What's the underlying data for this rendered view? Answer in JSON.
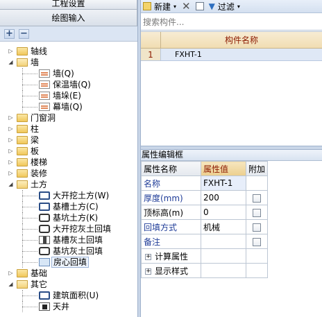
{
  "left": {
    "tab_top": "工程设置",
    "tab_draw": "绘图输入",
    "add_label": "+",
    "remove_label": "−",
    "tree": [
      {
        "label": "轴线",
        "level": 0,
        "exp": "▷",
        "icon": "folder-icon"
      },
      {
        "label": "墙",
        "level": 0,
        "exp": "◢",
        "icon": "folder-open-icon"
      },
      {
        "label": "墙(Q)",
        "level": 1,
        "icon": "wall-icon"
      },
      {
        "label": "保温墙(Q)",
        "level": 1,
        "icon": "insulation-wall-icon"
      },
      {
        "label": "墙垛(E)",
        "level": 1,
        "icon": "wall-pier-icon"
      },
      {
        "label": "幕墙(Q)",
        "level": 1,
        "icon": "curtain-wall-icon"
      },
      {
        "label": "门窗洞",
        "level": 0,
        "exp": "▷",
        "icon": "folder-icon"
      },
      {
        "label": "柱",
        "level": 0,
        "exp": "▷",
        "icon": "folder-icon"
      },
      {
        "label": "梁",
        "level": 0,
        "exp": "▷",
        "icon": "folder-icon"
      },
      {
        "label": "板",
        "level": 0,
        "exp": "▷",
        "icon": "folder-icon"
      },
      {
        "label": "楼梯",
        "level": 0,
        "exp": "▷",
        "icon": "folder-icon"
      },
      {
        "label": "装修",
        "level": 0,
        "exp": "▷",
        "icon": "folder-icon"
      },
      {
        "label": "土方",
        "level": 0,
        "exp": "◢",
        "icon": "folder-open-icon"
      },
      {
        "label": "大开挖土方(W)",
        "level": 1,
        "icon": "excavation-icon"
      },
      {
        "label": "基槽土方(C)",
        "level": 1,
        "icon": "trench-icon"
      },
      {
        "label": "基坑土方(K)",
        "level": 1,
        "icon": "pit-icon"
      },
      {
        "label": "大开挖灰土回填",
        "level": 1,
        "icon": "backfill-icon"
      },
      {
        "label": "基槽灰土回填",
        "level": 1,
        "icon": "trench-backfill-icon"
      },
      {
        "label": "基坑灰土回填",
        "level": 1,
        "icon": "pit-backfill-icon"
      },
      {
        "label": "房心回填",
        "level": 1,
        "icon": "room-backfill-icon",
        "selected": true
      },
      {
        "label": "基础",
        "level": 0,
        "exp": "▷",
        "icon": "folder-icon"
      },
      {
        "label": "其它",
        "level": 0,
        "exp": "◢",
        "icon": "folder-open-icon"
      },
      {
        "label": "建筑面积(U)",
        "level": 1,
        "icon": "building-area-icon"
      },
      {
        "label": "天井",
        "level": 1,
        "icon": "atrium-icon"
      }
    ]
  },
  "right": {
    "toolbar": {
      "new_label": "新建",
      "filter_label": "过滤"
    },
    "search_placeholder": "搜索构件...",
    "grid": {
      "header": "构件名称",
      "rows": [
        {
          "num": "1",
          "name": "FXHT-1"
        }
      ]
    },
    "props": {
      "title": "属性编辑框",
      "col_name": "属性名称",
      "col_value": "属性值",
      "col_extra": "附加",
      "rows": [
        {
          "name": "名称",
          "value": "FXHT-1",
          "checkbox": false
        },
        {
          "name": "厚度(mm)",
          "value": "200",
          "checkbox": true
        },
        {
          "name": "顶标高(m)",
          "value": "0",
          "checkbox": true
        },
        {
          "name": "回填方式",
          "value": "机械",
          "checkbox": true
        },
        {
          "name": "备注",
          "value": "",
          "checkbox": true
        }
      ],
      "groups": [
        "计算属性",
        "显示样式"
      ]
    }
  }
}
